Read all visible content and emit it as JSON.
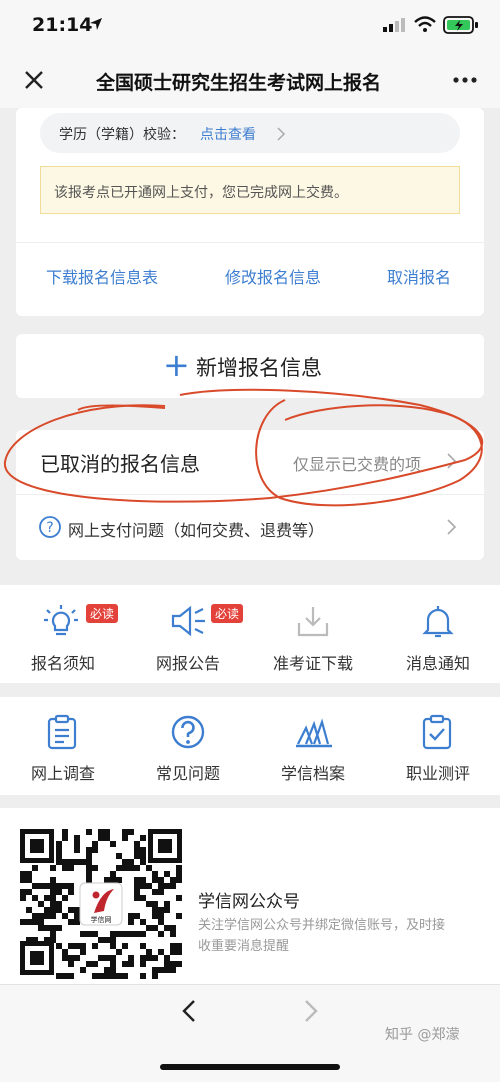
{
  "status": {
    "time": "21:14"
  },
  "header": {
    "title": "全国硕士研究生招生考试网上报名"
  },
  "education_check": {
    "label": "学历（学籍）校验：",
    "link": "点击查看"
  },
  "payment_notice": "该报考点已开通网上支付，您已完成网上交费。",
  "actions": {
    "download": "下载报名信息表",
    "modify": "修改报名信息",
    "cancel": "取消报名"
  },
  "add_button": {
    "plus": "+",
    "label": "新增报名信息"
  },
  "cancelled": {
    "title": "已取消的报名信息",
    "hint": "仅显示已交费的项"
  },
  "payment_issue": "网上支付问题（如何交费、退费等）",
  "grid1": [
    {
      "label": "报名须知",
      "badge": "必读"
    },
    {
      "label": "网报公告",
      "badge": "必读"
    },
    {
      "label": "准考证下载"
    },
    {
      "label": "消息通知"
    }
  ],
  "grid2": [
    {
      "label": "网上调查"
    },
    {
      "label": "常见问题"
    },
    {
      "label": "学信档案"
    },
    {
      "label": "职业测评"
    }
  ],
  "qr": {
    "title": "学信网公众号",
    "desc_line1": "关注学信网公众号并绑定微信账号，及时接",
    "desc_line2": "收重要消息提醒",
    "logo_text": "学信网"
  },
  "watermark": "知乎 @郑濛",
  "colors": {
    "accent": "#3d7ed0",
    "badge": "#e3423a",
    "annotation": "#d84a2a"
  }
}
